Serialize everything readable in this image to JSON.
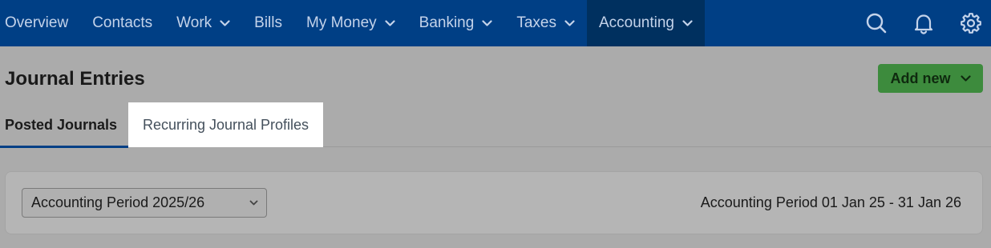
{
  "nav": {
    "items": [
      {
        "label": "Overview",
        "dropdown": false
      },
      {
        "label": "Contacts",
        "dropdown": false
      },
      {
        "label": "Work",
        "dropdown": true
      },
      {
        "label": "Bills",
        "dropdown": false
      },
      {
        "label": "My Money",
        "dropdown": true
      },
      {
        "label": "Banking",
        "dropdown": true
      },
      {
        "label": "Taxes",
        "dropdown": true
      },
      {
        "label": "Accounting",
        "dropdown": true,
        "active": true
      }
    ],
    "icons": [
      "search-icon",
      "bell-icon",
      "gear-icon"
    ]
  },
  "page": {
    "title": "Journal Entries",
    "add_new_label": "Add new"
  },
  "tabs": [
    {
      "label": "Posted Journals",
      "selected": true
    },
    {
      "label": "Recurring Journal Profiles",
      "selected": false
    }
  ],
  "filter": {
    "selected_period": "Accounting Period 2025/26",
    "period_range": "Accounting Period 01 Jan 25 - 31 Jan 26"
  },
  "colors": {
    "nav_bg": "#003f85",
    "nav_active_bg": "#00305f",
    "add_button": "#3d8b3d",
    "tab_underline": "#003f85"
  }
}
